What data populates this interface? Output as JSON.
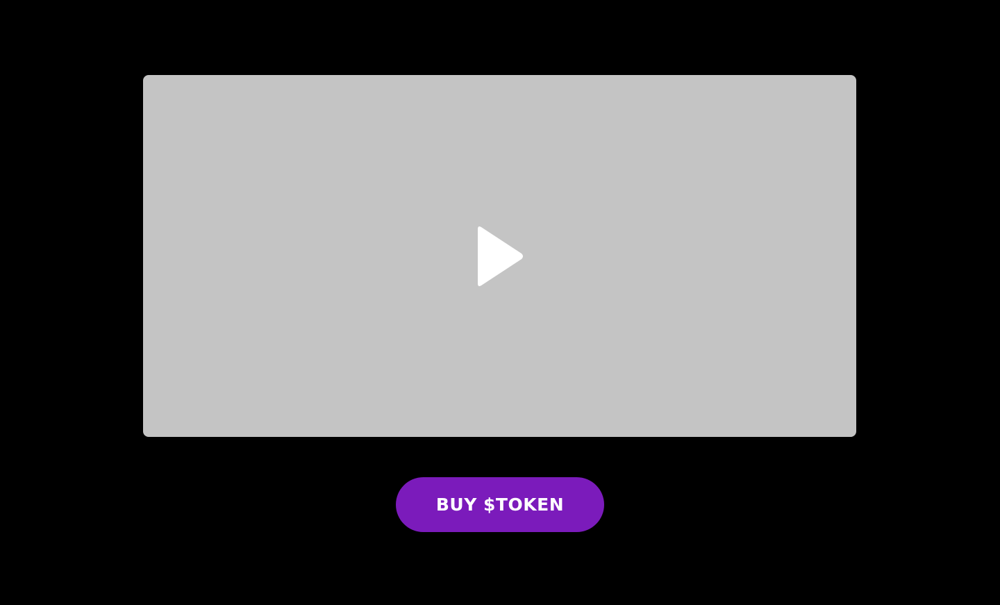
{
  "video": {
    "play_icon": "play-icon",
    "placeholder_color": "#c4c4c4"
  },
  "cta": {
    "buy_label": "BUY $TOKEN",
    "color": "#7b1bbb"
  },
  "theme": {
    "background": "#000000",
    "icon_color": "#ffffff"
  }
}
